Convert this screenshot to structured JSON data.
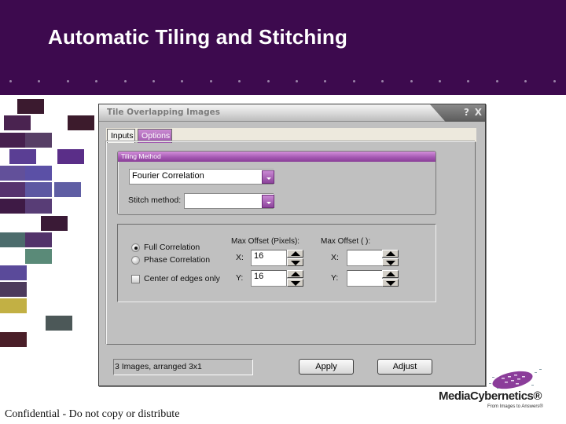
{
  "slide": {
    "title": "Automatic Tiling and Stitching",
    "footer": "Confidential - Do not copy or distribute",
    "brand_color": "#3d0a4e",
    "logo": {
      "name": "MediaCybernetics®",
      "tagline": "From Images to Answers®"
    }
  },
  "decor_tiles": [
    {
      "color": "#3b1a2f"
    },
    {
      "color": "#4a2350"
    },
    {
      "color": "#3c1b2c"
    },
    {
      "color": "#46204e"
    },
    {
      "color": "#573f66"
    },
    {
      "color": "#5a3e94"
    },
    {
      "color": "#5a2e88"
    },
    {
      "color": "#62509a"
    },
    {
      "color": "#5b50a6"
    },
    {
      "color": "#56336e"
    },
    {
      "color": "#5d58a2"
    },
    {
      "color": "#5f5ea4"
    },
    {
      "color": "#3e1a45"
    },
    {
      "color": "#583d76"
    },
    {
      "color": "#3a1a36"
    },
    {
      "color": "#4c6c6c"
    },
    {
      "color": "#52336a"
    },
    {
      "color": "#5a8a78"
    },
    {
      "color": "#5a4a9a"
    },
    {
      "color": "#4c3a5c"
    },
    {
      "color": "#c2b044"
    },
    {
      "color": "#4c5858"
    },
    {
      "color": "#4a1e28"
    }
  ],
  "dialog": {
    "title": "Tile Overlapping Images",
    "help_label": "?",
    "close_label": "X",
    "tabs": [
      {
        "label": "Inputs",
        "active": false
      },
      {
        "label": "Options",
        "active": true
      }
    ],
    "tiling_method": {
      "header": "Tiling Method",
      "method_value": "Fourier Correlation",
      "stitch_label": "Stitch method:",
      "stitch_value": ""
    },
    "correlation": {
      "radios": [
        {
          "label": "Full Correlation",
          "checked": true
        },
        {
          "label": "Phase Correlation",
          "checked": false
        }
      ],
      "checkbox": {
        "label": "Center of edges only",
        "checked": false
      },
      "max_offset_pixels": {
        "header": "Max Offset (Pixels):",
        "x_label": "X:",
        "x_value": "16",
        "y_label": "Y:",
        "y_value": "16"
      },
      "max_offset_units": {
        "header": "Max Offset ( ):",
        "x_label": "X:",
        "x_value": "",
        "y_label": "Y:",
        "y_value": ""
      }
    },
    "status": "3 Images, arranged 3x1",
    "apply_label": "Apply",
    "adjust_label": "Adjust"
  }
}
